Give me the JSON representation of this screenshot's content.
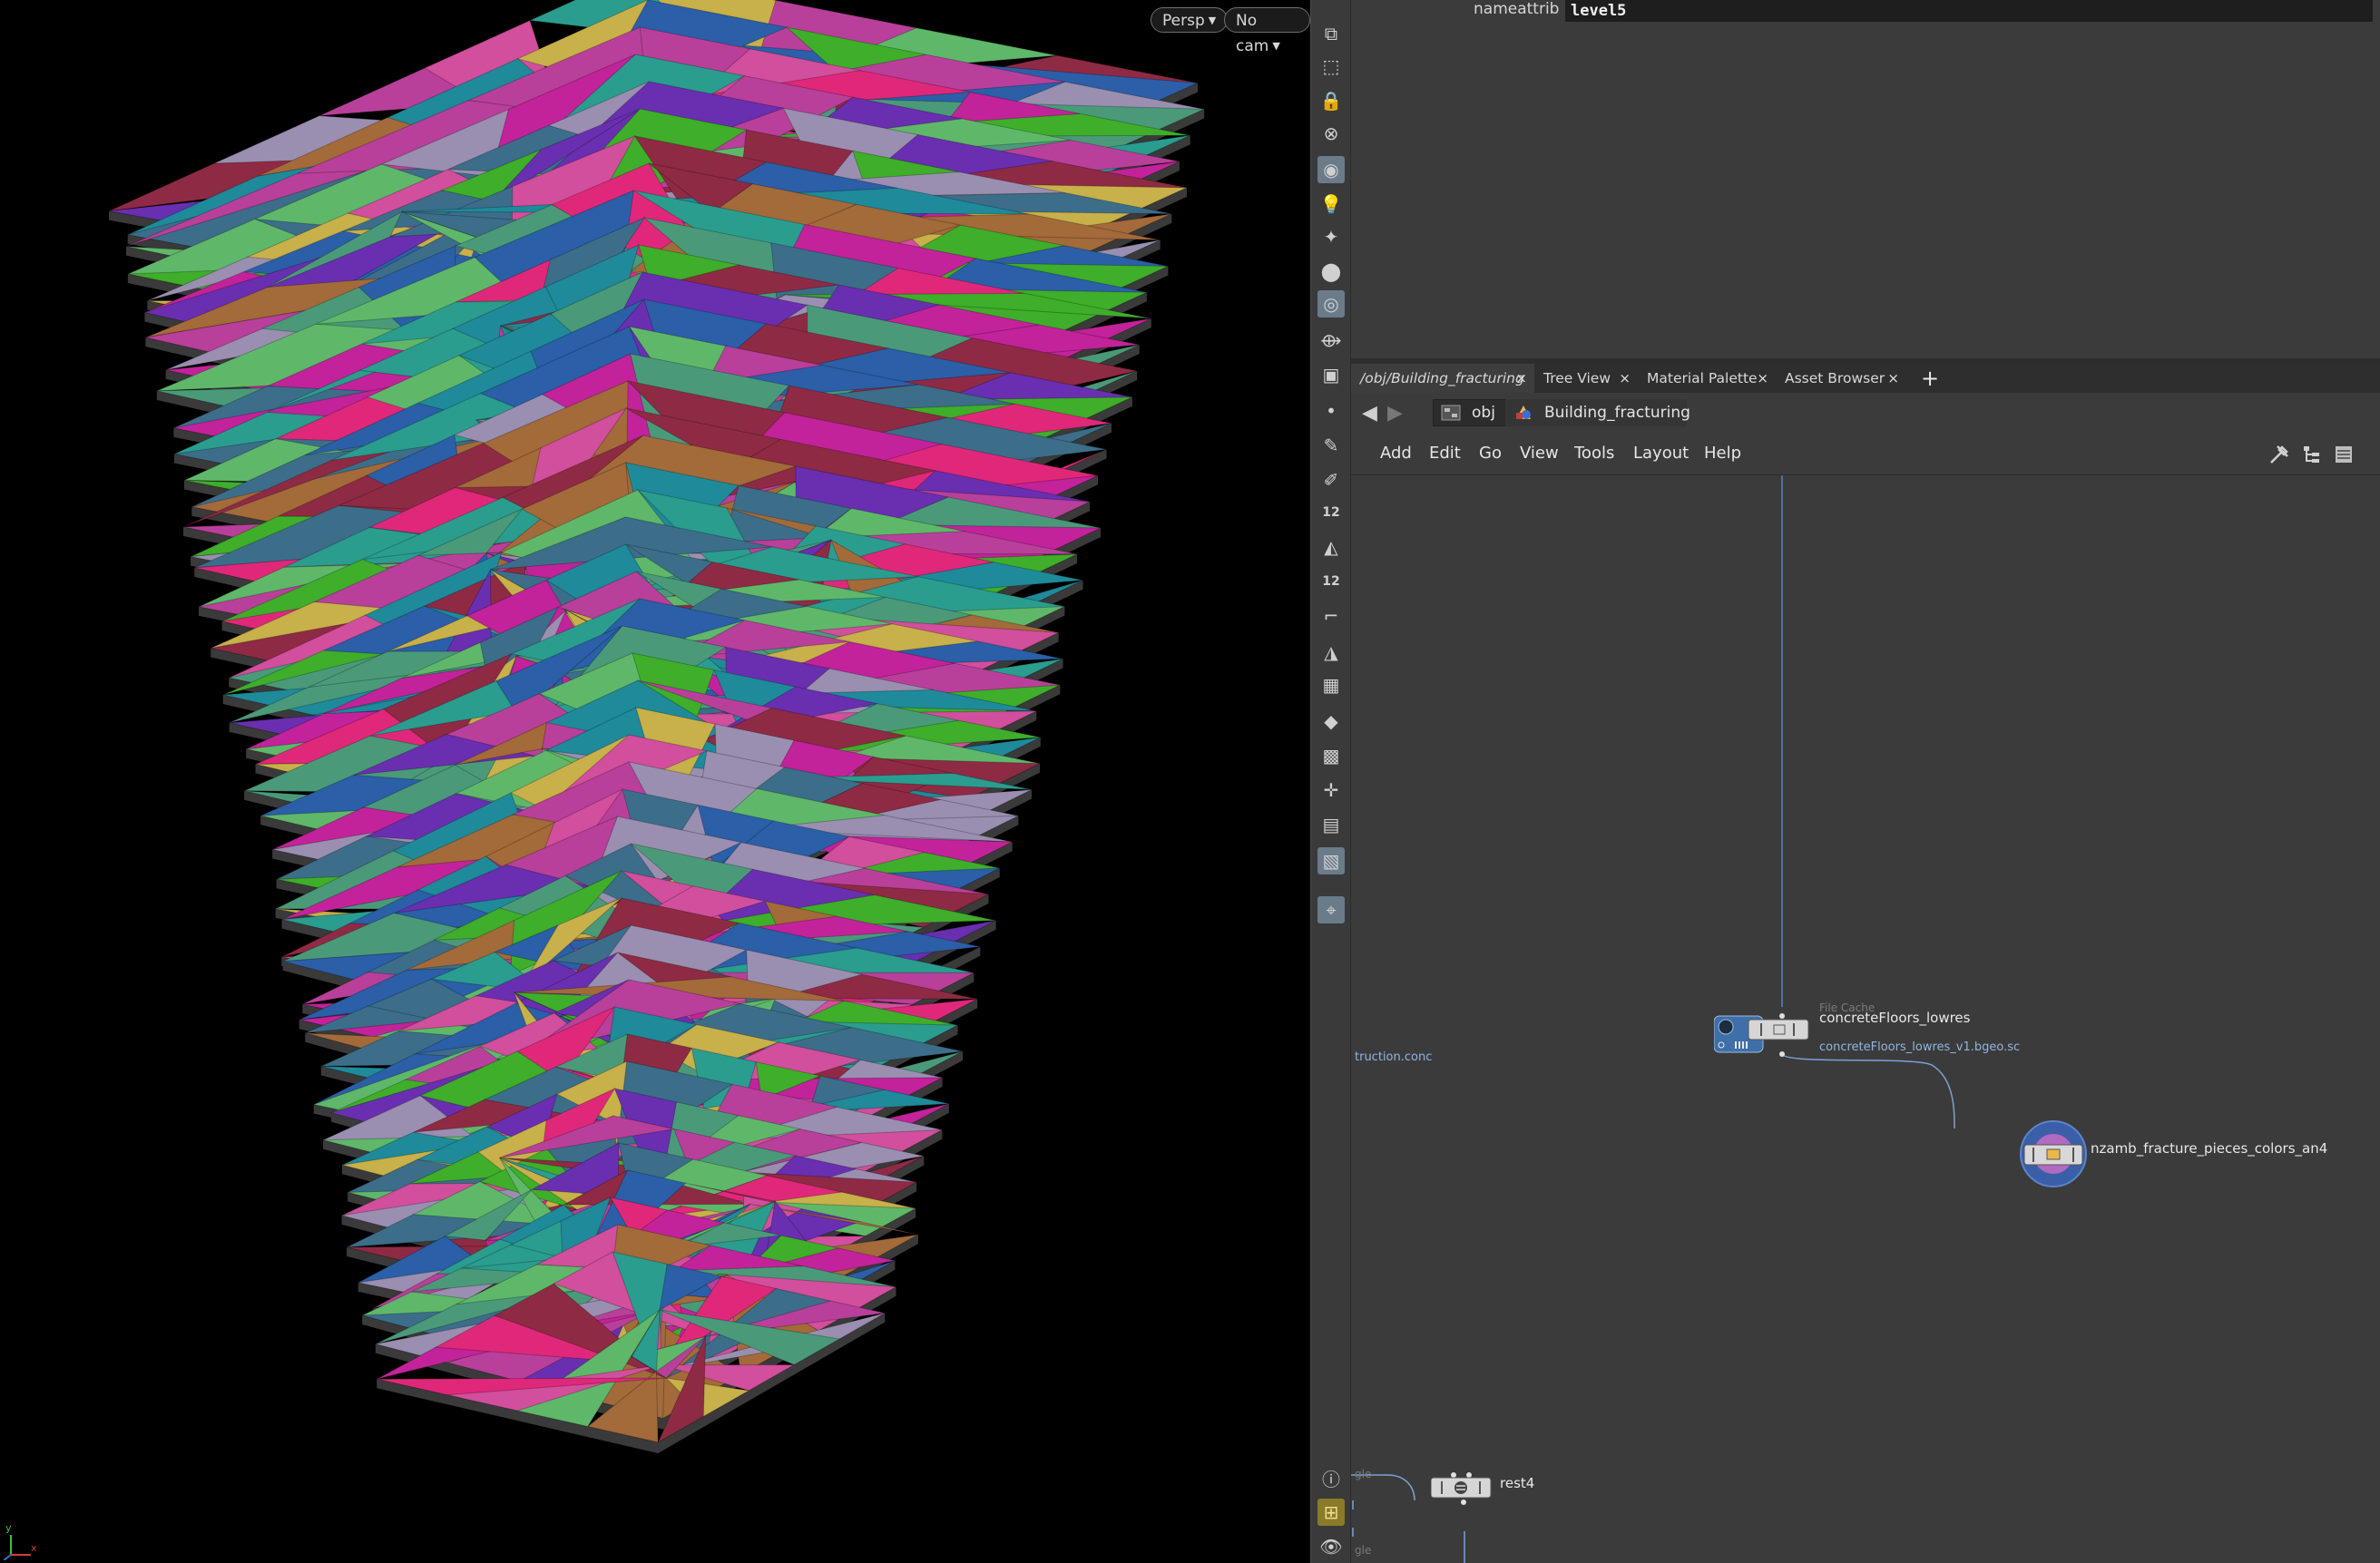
{
  "viewport": {
    "camera_mode": "Persp",
    "camera_select": "No cam",
    "axis_labels": [
      "y",
      "x"
    ],
    "colors": [
      "#c2239a",
      "#2a9d8f",
      "#6a2fb0",
      "#3fae2a",
      "#e0287a",
      "#1f8a9a",
      "#a36a3a",
      "#9a8fb0",
      "#c8b04a",
      "#2b5fa8",
      "#8f2a45",
      "#5fb86a",
      "#d14f9c",
      "#4a9a7a",
      "#b8409a",
      "#3c6e8a"
    ]
  },
  "shelf": {
    "tools": [
      "view-icon",
      "select-icon",
      "lock-icon",
      "close-circle-icon",
      "display-icon",
      "light-icon",
      "point-light-icon",
      "spot-light-icon",
      "camera-icon",
      "handle-icon",
      "render-icon",
      "dot-icon",
      "brush-icon",
      "pen-icon",
      "point-number-icon",
      "paint-icon",
      "prim-number-icon",
      "curve-icon",
      "shade-icon",
      "checker-icon",
      "plane-icon",
      "uv-icon",
      "snap-icon",
      "layer-icon",
      "background-icon",
      "pin-icon",
      "info-icon",
      "grid-icon",
      "eye-icon"
    ],
    "point_number_label": "12",
    "prim_number_label": "12"
  },
  "parameters": {
    "label": "nameattrib",
    "value": "level5"
  },
  "tabs": [
    {
      "label": "/obj/Building_fracturing",
      "active": true
    },
    {
      "label": "Tree View",
      "active": false
    },
    {
      "label": "Material Palette",
      "active": false
    },
    {
      "label": "Asset Browser",
      "active": false
    }
  ],
  "tab_close": "×",
  "tab_add": "+",
  "path": {
    "back": "🡸",
    "forward": "🡺",
    "root": "obj",
    "current": "Building_fracturing"
  },
  "menu": [
    "Add",
    "Edit",
    "Go",
    "View",
    "Tools",
    "Layout",
    "Help"
  ],
  "network": {
    "left_clip_label": "truction.conc",
    "left_clip_small": "gle",
    "left_clip_small2": "gle",
    "file_cache": {
      "type": "File Cache",
      "name": "concreteFloors_lowres",
      "file": "concreteFloors_lowres_v1.bgeo.sc"
    },
    "hda_node": {
      "name": "nzamb_fracture_pieces_colors_an4"
    },
    "rest_node": {
      "name": "rest4"
    }
  }
}
